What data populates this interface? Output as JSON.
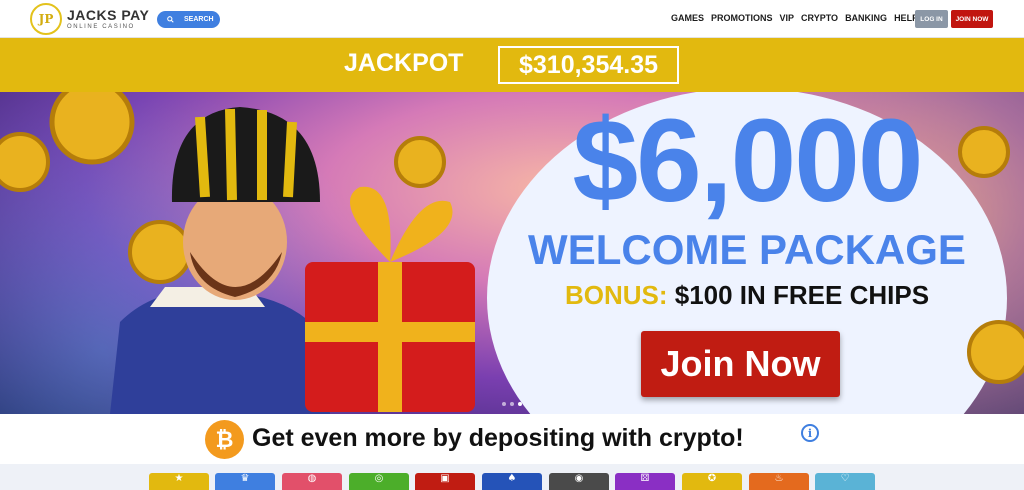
{
  "header": {
    "logo_name": "JACKS PAY",
    "logo_sub": "ONLINE CASINO",
    "logo_mark": "JP",
    "search_label": "SEARCH",
    "nav": [
      "GAMES",
      "PROMOTIONS",
      "VIP",
      "CRYPTO",
      "BANKING",
      "HELP"
    ],
    "login_label": "LOG IN",
    "join_label": "JOIN NOW"
  },
  "jackpot": {
    "label": "JACKPOT",
    "value": "$310,354.35"
  },
  "hero": {
    "amount": "$6,000",
    "title": "WELCOME PACKAGE",
    "bonus_label": "BONUS:",
    "bonus_value": "$100 IN FREE CHIPS",
    "cta": "Join Now",
    "slide_count": 3,
    "active_slide": 3
  },
  "crypto": {
    "icon": "bitcoin-icon",
    "text": "Get even more by depositing with crypto!",
    "info_icon": "info-icon"
  },
  "colors": {
    "brand_gold": "#e2b90f",
    "accent_blue": "#4a83ea",
    "cta_red": "#c01c12",
    "login_grey": "#8b97a6"
  },
  "category_tiles": [
    {
      "icon": "star-icon",
      "color": "#e2b90f"
    },
    {
      "icon": "crown-icon",
      "color": "#3f7fe0"
    },
    {
      "icon": "basketball-icon",
      "color": "#e2506a"
    },
    {
      "icon": "roulette-icon",
      "color": "#4cae2a"
    },
    {
      "icon": "slot-icon",
      "color": "#c01c12"
    },
    {
      "icon": "cards-icon",
      "color": "#2553b8"
    },
    {
      "icon": "poker-chip-icon",
      "color": "#4a4a4a"
    },
    {
      "icon": "dice-icon",
      "color": "#8a2fc4"
    },
    {
      "icon": "wheel-icon",
      "color": "#e2b90f"
    },
    {
      "icon": "flame-icon",
      "color": "#e46a1e"
    },
    {
      "icon": "heart-icon",
      "color": "#5ab3d6"
    }
  ]
}
